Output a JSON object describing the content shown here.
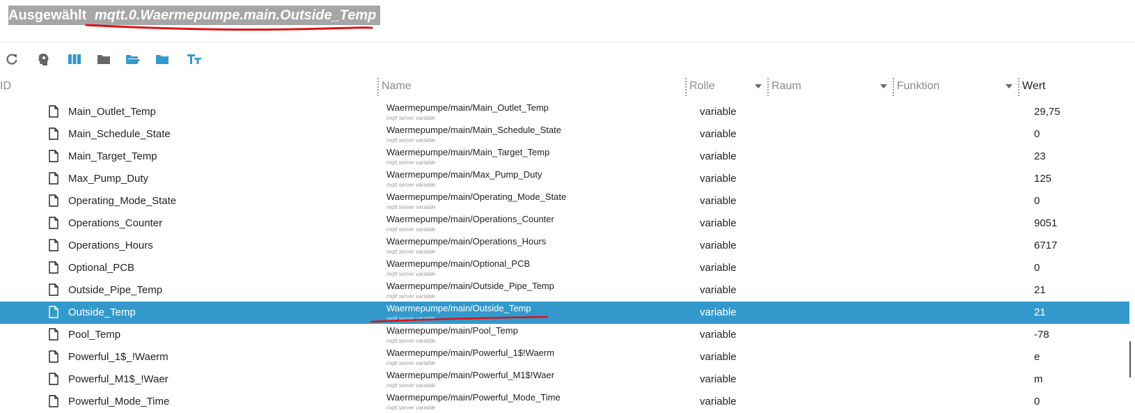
{
  "header": {
    "selected_label": "Ausgewählt",
    "selected_path": "mqtt.0.Waermepumpe.main.Outside_Temp"
  },
  "toolbar": {
    "buttons": [
      "refresh-icon",
      "expert-mode-icon",
      "columns-icon",
      "folder-icon",
      "folder-open-icon",
      "folder-blue-icon",
      "text-size-icon"
    ],
    "accent_color": "#3399cc"
  },
  "columns": {
    "id": "ID",
    "name": "Name",
    "role": "Rolle",
    "room": "Raum",
    "function": "Funktion",
    "value": "Wert"
  },
  "rows": [
    {
      "id": "Main_Outlet_Temp",
      "name": "Waermepumpe/main/Main_Outlet_Temp",
      "desc": "mqtt server variable",
      "role": "variable",
      "value": "29,75"
    },
    {
      "id": "Main_Schedule_State",
      "name": "Waermepumpe/main/Main_Schedule_State",
      "desc": "mqtt server variable",
      "role": "variable",
      "value": "0"
    },
    {
      "id": "Main_Target_Temp",
      "name": "Waermepumpe/main/Main_Target_Temp",
      "desc": "mqtt server variable",
      "role": "variable",
      "value": "23"
    },
    {
      "id": "Max_Pump_Duty",
      "name": "Waermepumpe/main/Max_Pump_Duty",
      "desc": "mqtt server variable",
      "role": "variable",
      "value": "125"
    },
    {
      "id": "Operating_Mode_State",
      "name": "Waermepumpe/main/Operating_Mode_State",
      "desc": "mqtt server variable",
      "role": "variable",
      "value": "0"
    },
    {
      "id": "Operations_Counter",
      "name": "Waermepumpe/main/Operations_Counter",
      "desc": "mqtt server variable",
      "role": "variable",
      "value": "9051"
    },
    {
      "id": "Operations_Hours",
      "name": "Waermepumpe/main/Operations_Hours",
      "desc": "mqtt server variable",
      "role": "variable",
      "value": "6717"
    },
    {
      "id": "Optional_PCB",
      "name": "Waermepumpe/main/Optional_PCB",
      "desc": "mqtt server variable",
      "role": "variable",
      "value": "0"
    },
    {
      "id": "Outside_Pipe_Temp",
      "name": "Waermepumpe/main/Outside_Pipe_Temp",
      "desc": "mqtt server variable",
      "role": "variable",
      "value": "21"
    },
    {
      "id": "Outside_Temp",
      "name": "Waermepumpe/main/Outside_Temp",
      "desc": "mqtt server variable",
      "role": "variable",
      "value": "21",
      "selected": true
    },
    {
      "id": "Pool_Temp",
      "name": "Waermepumpe/main/Pool_Temp",
      "desc": "mqtt server variable",
      "role": "variable",
      "value": "-78"
    },
    {
      "id": "Powerful_1$_!Waerm",
      "name": "Waermepumpe/main/Powerful_1$!Waerm",
      "desc": "mqtt server variable",
      "role": "variable",
      "value": "e"
    },
    {
      "id": "Powerful_M1$_!Waer",
      "name": "Waermepumpe/main/Powerful_M1$!Waer",
      "desc": "mqtt server variable",
      "role": "variable",
      "value": "m"
    },
    {
      "id": "Powerful_Mode_Time",
      "name": "Waermepumpe/main/Powerful_Mode_Time",
      "desc": "mqtt server variable",
      "role": "variable",
      "value": "0"
    }
  ]
}
